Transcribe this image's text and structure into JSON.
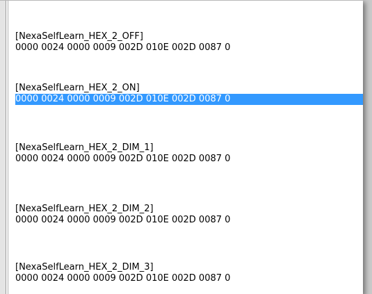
{
  "editor": {
    "colors": {
      "selection_background": "#3399ff",
      "selection_text": "#ffffff"
    },
    "entries": [
      {
        "section": "[NexaSelfLearn_HEX_2_OFF]",
        "data": "0000 0024 0000 0009 002D 010E 002D 0087 0"
      },
      {
        "section": "[NexaSelfLearn_HEX_2_ON]",
        "data": "0000 0024 0000 0009 002D 010E 002D 0087 0",
        "selected": true
      },
      {
        "section": "[NexaSelfLearn_HEX_2_DIM_1]",
        "data": "0000 0024 0000 0009 002D 010E 002D 0087 0"
      },
      {
        "section": "[NexaSelfLearn_HEX_2_DIM_2]",
        "data": "0000 0024 0000 0009 002D 010E 002D 0087 0"
      },
      {
        "section": "[NexaSelfLearn_HEX_2_DIM_3]",
        "data": "0000 0024 0000 0009 002D 010E 002D 0087 0"
      }
    ]
  }
}
